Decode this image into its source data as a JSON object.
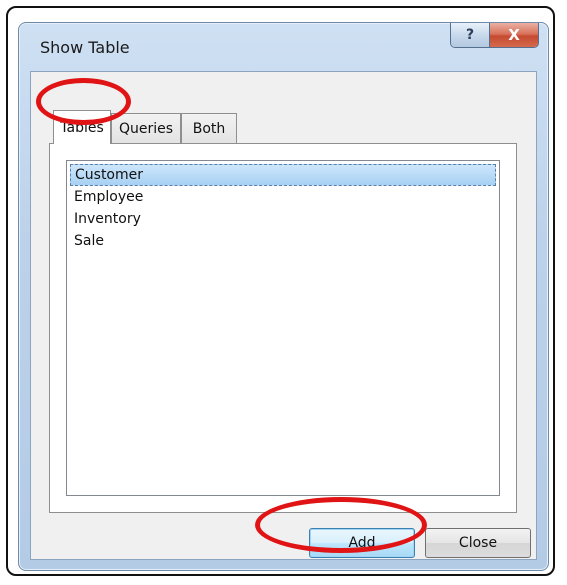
{
  "window": {
    "title": "Show Table",
    "help_glyph": "?",
    "close_glyph": "X"
  },
  "tabs": [
    {
      "label": "Tables",
      "active": true
    },
    {
      "label": "Queries",
      "active": false
    },
    {
      "label": "Both",
      "active": false
    }
  ],
  "list": {
    "items": [
      {
        "label": "Customer",
        "selected": true
      },
      {
        "label": "Employee",
        "selected": false
      },
      {
        "label": "Inventory",
        "selected": false
      },
      {
        "label": "Sale",
        "selected": false
      }
    ]
  },
  "buttons": {
    "add_label": "Add",
    "close_label": "Close"
  },
  "annotations": {
    "highlight_color": "#e01414",
    "highlighted": [
      "Tables tab",
      "Add button"
    ]
  }
}
